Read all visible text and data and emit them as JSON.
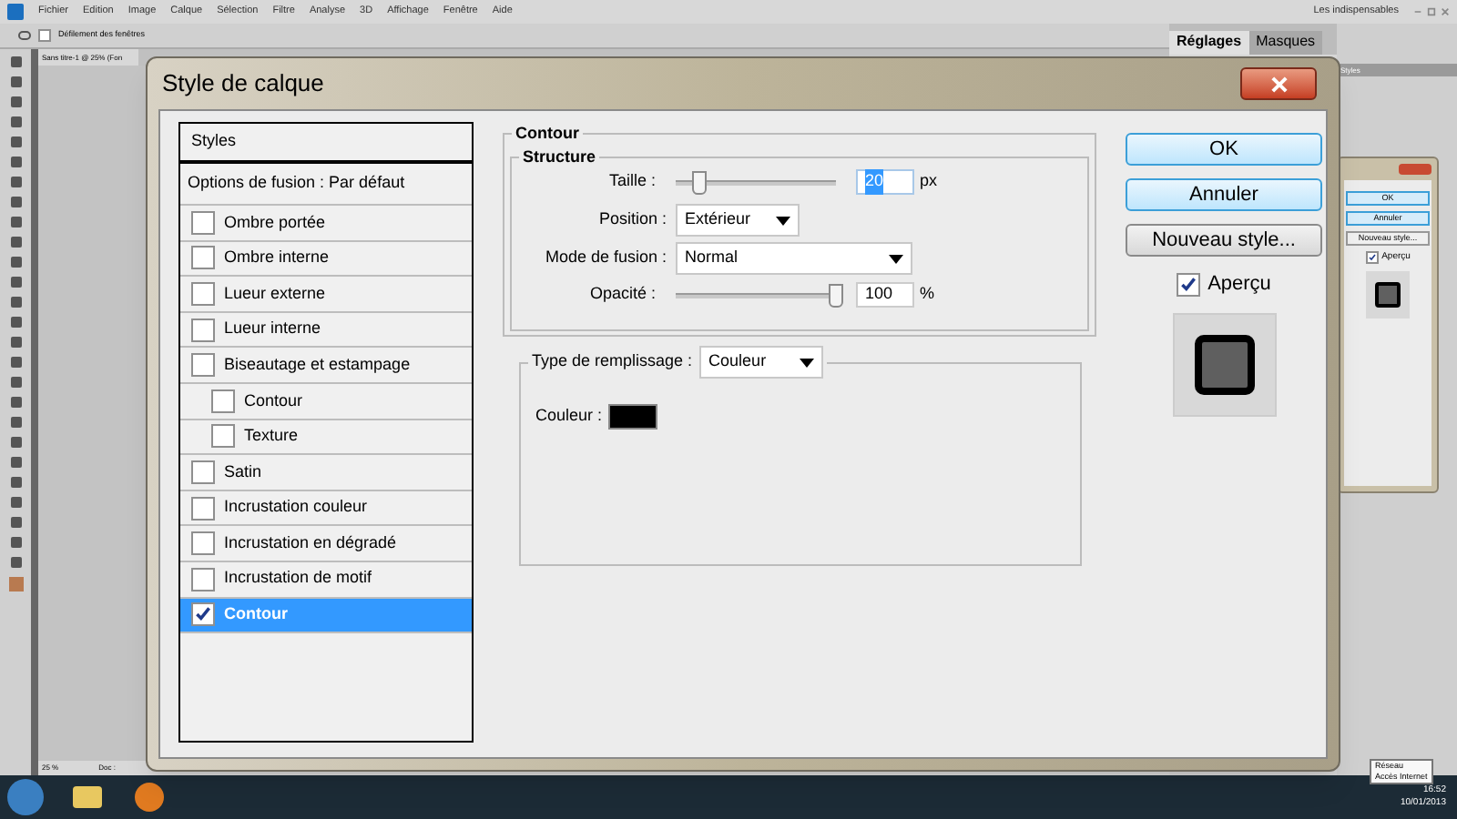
{
  "app": {
    "menu": [
      "Fichier",
      "Edition",
      "Image",
      "Calque",
      "Sélection",
      "Filtre",
      "Analyse",
      "3D",
      "Affichage",
      "Fenêtre",
      "Aide"
    ],
    "workspace": "Les indispensables",
    "options_bar": {
      "label": "Défilement des fenêtres",
      "checked": false
    },
    "document_tab": "Sans titre-1 @ 25% (Fon",
    "panel_tabs": [
      {
        "label": "Réglages",
        "selected": true
      },
      {
        "label": "Masques",
        "selected": false
      }
    ],
    "styles_panel": "Styles",
    "status": {
      "zoom": "25 %",
      "doc": "Doc :"
    }
  },
  "dialog": {
    "title": "Style de calque",
    "styles_header": "Styles",
    "blend_options": "Options de fusion : Par défaut",
    "effects": [
      {
        "label": "Ombre portée",
        "checked": false,
        "selected": false
      },
      {
        "label": "Ombre interne",
        "checked": false,
        "selected": false
      },
      {
        "label": "Lueur externe",
        "checked": false,
        "selected": false
      },
      {
        "label": "Lueur interne",
        "checked": false,
        "selected": false
      },
      {
        "label": "Biseautage et estampage",
        "checked": false,
        "selected": false,
        "children": [
          {
            "label": "Contour",
            "checked": false,
            "selected": false
          },
          {
            "label": "Texture",
            "checked": false,
            "selected": false
          }
        ]
      },
      {
        "label": "Satin",
        "checked": false,
        "selected": false
      },
      {
        "label": "Incrustation couleur",
        "checked": false,
        "selected": false
      },
      {
        "label": "Incrustation en dégradé",
        "checked": false,
        "selected": false
      },
      {
        "label": "Incrustation de motif",
        "checked": false,
        "selected": false
      },
      {
        "label": "Contour",
        "checked": true,
        "selected": true
      }
    ],
    "section_title": "Contour",
    "structure_title": "Structure",
    "size": {
      "label": "Taille :",
      "value": "20",
      "unit": "px",
      "level": 0.15
    },
    "position": {
      "label": "Position :",
      "value": "Extérieur"
    },
    "blend_mode": {
      "label": "Mode de fusion :",
      "value": "Normal"
    },
    "opacity": {
      "label": "Opacité :",
      "value": "100",
      "unit": "%",
      "level": 1
    },
    "fill_type": {
      "label": "Type de remplissage :",
      "value": "Couleur"
    },
    "color": {
      "label": "Couleur :",
      "color": "#000000"
    },
    "buttons": [
      "OK",
      "Annuler",
      "Nouveau style..."
    ],
    "preview": {
      "label": "Aperçu",
      "checked": true
    }
  },
  "mirror_dialog": {
    "buttons": [
      "OK",
      "Annuler",
      "Nouveau style..."
    ],
    "preview": {
      "label": "Aperçu",
      "checked": true
    }
  },
  "taskbar": {
    "tooltip": [
      "Réseau",
      "Accès Internet"
    ],
    "time": "16:52",
    "date": "10/01/2013"
  }
}
